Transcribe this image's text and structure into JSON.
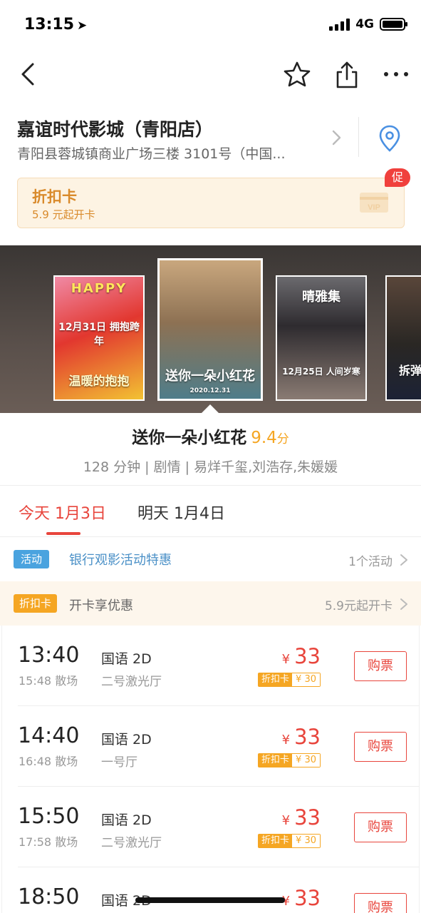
{
  "status_bar": {
    "time": "13:15",
    "network": "4G"
  },
  "cinema": {
    "name": "嘉谊时代影城（青阳店）",
    "address": "青阳县蓉城镇商业广场三楼 3101号（中国..."
  },
  "discount_card": {
    "title": "折扣卡",
    "subtitle": "5.9 元起开卡",
    "vip_text": "VIP",
    "badge": "促"
  },
  "posters": [
    {
      "line1": "HAPPY",
      "line2": "12月31日 拥抱跨年",
      "line3": "温暖的抱抱"
    },
    {
      "line1": "送你一朵小红花",
      "line2": "2020.12.31"
    },
    {
      "line1": "晴雅集",
      "line2": "12月25日 人间岁寒"
    },
    {
      "line1": "拆弹"
    }
  ],
  "movie": {
    "title": "送你一朵小红花",
    "score": "9.4",
    "score_unit": "分",
    "meta": "128 分钟 | 剧情 | 易烊千玺,刘浩存,朱媛媛"
  },
  "date_tabs": [
    {
      "label": "今天 1月3日",
      "active": true
    },
    {
      "label": "明天 1月4日",
      "active": false
    }
  ],
  "activity": {
    "tag": "活动",
    "text": "银行观影活动特惠",
    "right": "1个活动"
  },
  "card_promo": {
    "tag": "折扣卡",
    "text": "开卡享优惠",
    "right": "5.9元起开卡"
  },
  "showtimes": [
    {
      "start": "13:40",
      "end": "15:48 散场",
      "lang": "国语 2D",
      "hall": "二号激光厅",
      "currency": "¥",
      "price": "33",
      "card_label": "折扣卡",
      "card_price": "¥ 30",
      "buy": "购票"
    },
    {
      "start": "14:40",
      "end": "16:48 散场",
      "lang": "国语 2D",
      "hall": "一号厅",
      "currency": "¥",
      "price": "33",
      "card_label": "折扣卡",
      "card_price": "¥ 30",
      "buy": "购票"
    },
    {
      "start": "15:50",
      "end": "17:58 散场",
      "lang": "国语 2D",
      "hall": "二号激光厅",
      "currency": "¥",
      "price": "33",
      "card_label": "折扣卡",
      "card_price": "¥ 30",
      "buy": "购票"
    },
    {
      "start": "18:50",
      "end": "",
      "lang": "国语 2D",
      "hall": "",
      "currency": "¥",
      "price": "33",
      "card_label": "",
      "card_price": "",
      "buy": "购票"
    }
  ],
  "colors": {
    "accent": "#e8453c",
    "gold": "#f5a623",
    "blue": "#4aa3df"
  }
}
